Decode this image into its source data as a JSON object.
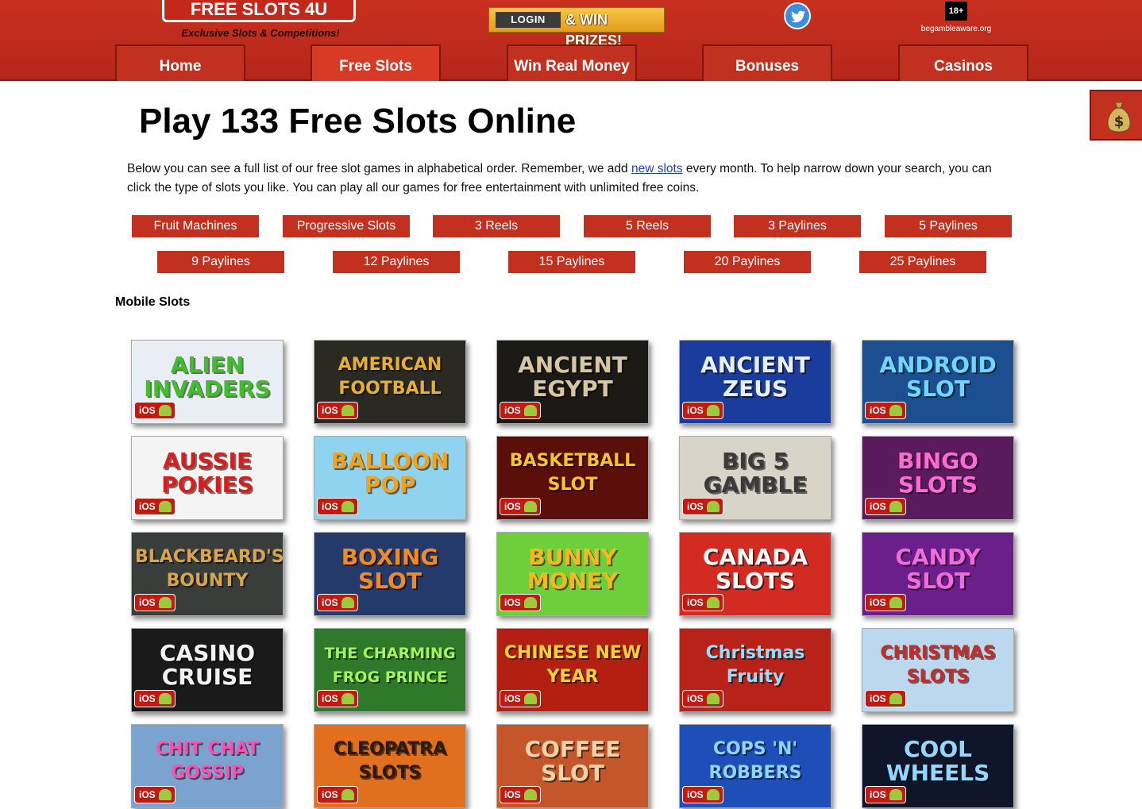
{
  "header": {
    "logo": "FREE SLOTS 4U",
    "tagline": "Exclusive Slots & Competitions!",
    "login_label": "LOGIN",
    "win_prizes": "& WIN PRIZES!",
    "age_badge": "18+",
    "gamble_aware": "begambleaware.org"
  },
  "nav": [
    "Home",
    "Free Slots",
    "Win Real Money",
    "Bonuses",
    "Casinos"
  ],
  "main": {
    "title": "Play 133 Free Slots Online",
    "intro_before": "Below you can see a full list of our free slot games in alphabetical order. Remember, we add ",
    "intro_link": "new slots",
    "intro_after": " every month. To help narrow down your search, you can click the type of slots you like. You can play all our games for free entertainment with unlimited free coins.",
    "filters_row1": [
      "Fruit Machines",
      "Progressive Slots",
      "3 Reels",
      "5 Reels",
      "3 Paylines",
      "5 Paylines"
    ],
    "filters_row2": [
      "9 Paylines",
      "12 Paylines",
      "15 Paylines",
      "20 Paylines",
      "25 Paylines"
    ],
    "section_title": "Mobile Slots"
  },
  "badge": {
    "ios": "iOS"
  },
  "games": [
    {
      "title": "ALIEN INVADERS",
      "bg": "#e8eef4",
      "color": "#3fbf2a"
    },
    {
      "title": "AMERICAN FOOTBALL",
      "bg": "#2b2a22",
      "color": "#e8b030"
    },
    {
      "title": "ANCIENT EGYPT",
      "bg": "#1c1a16",
      "color": "#d6c7a0"
    },
    {
      "title": "ANCIENT ZEUS",
      "bg": "#1a3c9c",
      "color": "#e8f0ff"
    },
    {
      "title": "ANDROID SLOT",
      "bg": "#1b4f8f",
      "color": "#6fd6ff"
    },
    {
      "title": "AUSSIE POKIES",
      "bg": "#f4f4f4",
      "color": "#d41f1f"
    },
    {
      "title": "BALLOON POP",
      "bg": "#8fd3ee",
      "color": "#f3a21a"
    },
    {
      "title": "BASKETBALL SLOT",
      "bg": "#5a0f0b",
      "color": "#f7c32a"
    },
    {
      "title": "BIG 5 GAMBLE",
      "bg": "#d9d4c8",
      "color": "#3a3a3a"
    },
    {
      "title": "BINGO SLOTS",
      "bg": "#5a1a5e",
      "color": "#ff6ad5"
    },
    {
      "title": "BLACKBEARD'S BOUNTY",
      "bg": "#3a3e3a",
      "color": "#d8a54a"
    },
    {
      "title": "BOXING SLOT",
      "bg": "#243a6a",
      "color": "#f18a1f"
    },
    {
      "title": "BUNNY MONEY",
      "bg": "#6fcf3a",
      "color": "#f6b81e"
    },
    {
      "title": "CANADA SLOTS",
      "bg": "#d32a22",
      "color": "#ffffff"
    },
    {
      "title": "CANDY SLOT",
      "bg": "#6a1f8a",
      "color": "#f06bdc"
    },
    {
      "title": "CASINO CRUISE",
      "bg": "#1a1a1a",
      "color": "#f2f2f2"
    },
    {
      "title": "THE CHARMING FROG PRINCE",
      "bg": "#2f7a2a",
      "color": "#a5f25a"
    },
    {
      "title": "CHINESE NEW YEAR",
      "bg": "#b32012",
      "color": "#f5d23a"
    },
    {
      "title": "Christmas Fruity",
      "bg": "#b82218",
      "color": "#8ae0ff"
    },
    {
      "title": "CHRISTMAS SLOTS",
      "bg": "#bcd8ee",
      "color": "#c92a26"
    },
    {
      "title": "CHIT CHAT GOSSIP",
      "bg": "#7aa3cf",
      "color": "#ff4fb0"
    },
    {
      "title": "CLEOPATRA SLOTS",
      "bg": "#e0701e",
      "color": "#2a1a10"
    },
    {
      "title": "COFFEE SLOT",
      "bg": "#c4562a",
      "color": "#f3d4a8"
    },
    {
      "title": "COPS 'N' ROBBERS",
      "bg": "#1e4fb8",
      "color": "#8cd6ff"
    },
    {
      "title": "COOL WHEELS",
      "bg": "#10162a",
      "color": "#8fd8ff"
    }
  ],
  "colors": {
    "brand_red": "#c3301f",
    "header_bg": "#b5271a"
  }
}
